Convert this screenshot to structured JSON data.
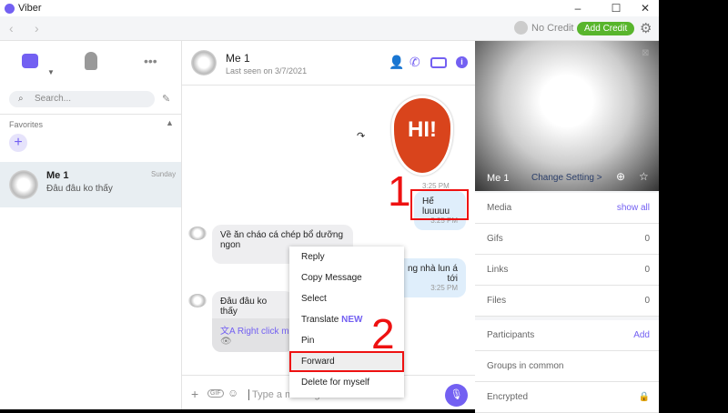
{
  "window": {
    "title": "Viber",
    "minimize": "–",
    "maximize": "☐",
    "close": "✕"
  },
  "toolbar": {
    "back": "‹",
    "forward": "›",
    "credit": "No Credit",
    "add_credit": "Add Credit"
  },
  "sidebar": {
    "search_placeholder": "Search...",
    "favorites": "Favorites",
    "add": "+",
    "conversations": [
      {
        "name": "Me 1",
        "preview": "Đâu đâu ko thấy",
        "date": "Sunday"
      }
    ]
  },
  "chat": {
    "name": "Me 1",
    "status": "Last seen on 3/7/2021",
    "input_placeholder": "Type a message...",
    "messages": [
      {
        "dir": "out",
        "type": "sticker",
        "text": "HI!",
        "time": "3:25 PM"
      },
      {
        "dir": "out",
        "text": "Hế luuuuu",
        "time": "3:25 PM"
      },
      {
        "dir": "in",
        "text": "Về ăn cháo cá chép bổ dưỡng ngon",
        "time": "3:25 PM"
      },
      {
        "dir": "out",
        "text": "ng nhà lun á tới",
        "time": "3:25 PM"
      },
      {
        "dir": "in",
        "text": "Đâu đâu ko thấy",
        "translate_hint": "Right click mess"
      }
    ]
  },
  "context_menu": {
    "items": [
      "Reply",
      "Copy Message",
      "Select",
      "Translate",
      "Pin",
      "Forward",
      "Delete for myself"
    ],
    "new_badge": "NEW"
  },
  "annotations": {
    "step1": "1",
    "step2": "2"
  },
  "info": {
    "name": "Me 1",
    "change_setting": "Change Setting >",
    "media": "Media",
    "show_all": "show all",
    "rows": [
      {
        "label": "Gifs",
        "count": "0"
      },
      {
        "label": "Links",
        "count": "0"
      },
      {
        "label": "Files",
        "count": "0"
      }
    ],
    "participants": "Participants",
    "add": "Add",
    "groups": "Groups in common",
    "encrypted": "Encrypted"
  },
  "colors": {
    "accent": "#7360f2",
    "credit": "#58b52c",
    "highlight": "#e11111"
  }
}
